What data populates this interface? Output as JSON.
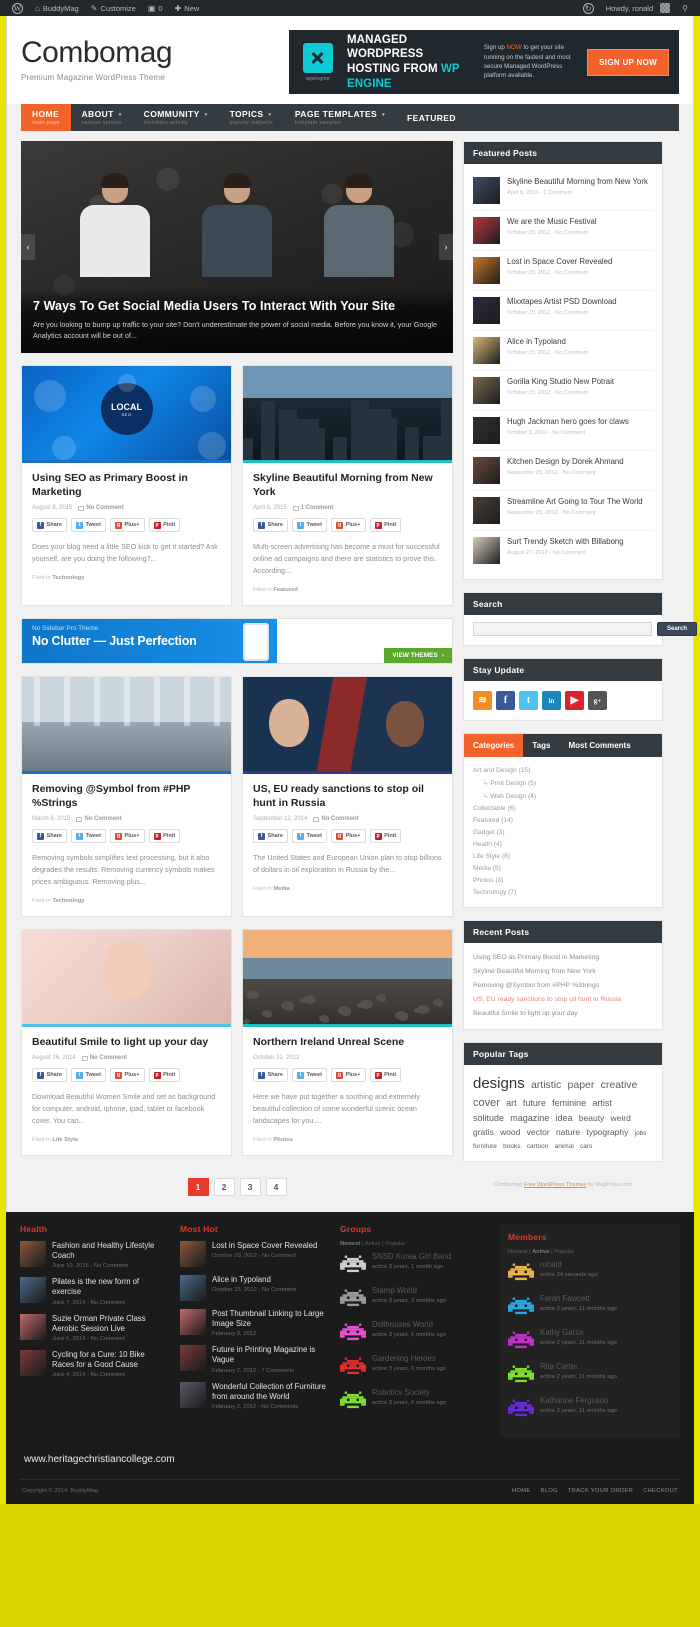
{
  "adminbar": {
    "wp_logo": "wordpress-logo-icon",
    "site_name": "BuddyMag",
    "customize": "Customize",
    "comment_count": "0",
    "new": "New",
    "howdy": "Howdy, ronald",
    "updates_icon": "updates-icon",
    "search_icon": "search-icon"
  },
  "header": {
    "title": "Combomag",
    "tagline": "Premium Magazine WordPress Theme",
    "ad": {
      "logo_label": "wpengine",
      "headline_line1": "MANAGED WORDPRESS",
      "headline_line2": "HOSTING FROM ",
      "headline_brand": "WP ENGINE",
      "body_pre": "Sign up ",
      "body_now": "NOW",
      "body_post": " to get your site running on the fastest and most secure Managed WordPress platform available.",
      "cta": "SIGN UP NOW"
    }
  },
  "nav": [
    {
      "label": "HOME",
      "desc": "main page",
      "caret": false,
      "active": true
    },
    {
      "label": "ABOUT",
      "desc": "various options",
      "caret": true,
      "active": false
    },
    {
      "label": "COMMUNITY",
      "desc": "members activity",
      "caret": true,
      "active": false
    },
    {
      "label": "TOPICS",
      "desc": "popular subjects",
      "caret": true,
      "active": false
    },
    {
      "label": "PAGE TEMPLATES",
      "desc": "template samples",
      "caret": true,
      "active": false
    },
    {
      "label": "FEATURED",
      "desc": "",
      "caret": false,
      "active": false
    }
  ],
  "hero": {
    "title": "7 Ways To Get Social Media Users To Interact With Your Site",
    "excerpt": "Are you looking to bump up traffic to your site? Don't underestimate the power of social media. Before you know it, your Google Analytics account will be out of...",
    "prev_icon": "chevron-left-icon",
    "next_icon": "chevron-right-icon"
  },
  "share": {
    "facebook": "Share",
    "twitter": "Tweet",
    "google": "Plus+",
    "pinterest": "Pinit"
  },
  "filed_label": "Filed in",
  "articles": [
    {
      "title": "Using SEO as Primary Boost in Marketing",
      "date": "August 8, 2015",
      "comments": "No Comment",
      "excerpt": "Does your blog need a little SEO kick to get it started? Ask yourself, are you doing the following?...",
      "filed": "Technology",
      "thumb": "seo-infographic-thumbnail",
      "accent": "#1b6fc4"
    },
    {
      "title": "Skyline Beautiful Morning from New York",
      "date": "April 8, 2015",
      "comments": "1 Comment",
      "excerpt": "Multi-screen advertising has become a must for successful online ad campaigns and there are statistics to prove this. According...",
      "filed": "Featured",
      "thumb": "city-skyline-thumbnail",
      "accent": "#1cc2c2"
    },
    {
      "title": "Removing @Symbol from #PHP %Strings",
      "date": "March 8, 2015",
      "comments": "No Comment",
      "excerpt": "Removing symbols simplifies text processing, but it also degrades the results. Removing currency symbols makes prices ambiguous. Removing plus...",
      "filed": "Technology",
      "thumb": "office-interior-thumbnail",
      "accent": "#1b6fc4"
    },
    {
      "title": "US, EU ready sanctions to stop oil hunt in Russia",
      "date": "September 12, 2014",
      "comments": "No Comment",
      "excerpt": "The United States and European Union plan to stop billions of dollars in oil exploration in Russia by the...",
      "filed": "Media",
      "thumb": "politicians-thumbnail",
      "accent": "#2b3a8f"
    },
    {
      "title": "Beautiful Smile to light up your day",
      "date": "August 26, 2014",
      "comments": "No Comment",
      "excerpt": "Download Beautiful Women Smile and set as background for computer, android, iphone, ipad, tablet or facebook cover. You can...",
      "filed": "Life Style",
      "thumb": "smiling-woman-thumbnail",
      "accent": "#4fc3e8"
    },
    {
      "title": "Northern Ireland Unreal Scene",
      "date": "October 21, 2012",
      "comments": "",
      "excerpt": "Here we have put together a soothing and extremely beautiful collection of some wonderful scenic ocean landscapes for you....",
      "filed": "Photos",
      "thumb": "coastal-ruins-thumbnail",
      "accent": "#1cc2c2"
    }
  ],
  "midbanner": {
    "small": "No Sidebar Pro Theme",
    "big": "No Clutter — Just Perfection",
    "cta": "VIEW THEMES",
    "cta_icon": "chevron-right-icon"
  },
  "pagination": {
    "pages": [
      "1",
      "2",
      "3",
      "4"
    ],
    "current": "1"
  },
  "sidebar": {
    "featured_posts": {
      "title": "Featured Posts",
      "items": [
        {
          "title": "Skyline Beautiful Morning from New York",
          "meta": "April 8, 2015 - 1 Comment",
          "thumb": "skyline-thumb"
        },
        {
          "title": "We are the Music Festival",
          "meta": "October 20, 2012 - No Comment",
          "thumb": "music-festival-thumb"
        },
        {
          "title": "Lost in Space Cover Revealed",
          "meta": "October 20, 2012 - No Comment",
          "thumb": "lost-in-space-thumb"
        },
        {
          "title": "Mixxtapes Artist PSD Download",
          "meta": "October 15, 2012 - No Comment",
          "thumb": "mixxtapes-thumb"
        },
        {
          "title": "Alice in Typoland",
          "meta": "October 15, 2012 - No Comment",
          "thumb": "alice-typoland-thumb"
        },
        {
          "title": "Gorilla King Studio New Potrait",
          "meta": "October 15, 2012 - No Comment",
          "thumb": "gorilla-king-thumb"
        },
        {
          "title": "Hugh Jackman hero goes for claws",
          "meta": "October 3, 2012 - No Comment",
          "thumb": "hugh-jackman-thumb"
        },
        {
          "title": "Kitchen Design by Dorek Ahmand",
          "meta": "September 29, 2012 - No Comment",
          "thumb": "kitchen-design-thumb"
        },
        {
          "title": "Streamline Art Going to Tour The World",
          "meta": "September 29, 2012 - No Comment",
          "thumb": "streamline-art-thumb"
        },
        {
          "title": "Surt Trendy Sketch with Billabong",
          "meta": "August 27, 2012 - No Comment",
          "thumb": "surf-sketch-thumb"
        }
      ]
    },
    "search": {
      "title": "Search",
      "value": "",
      "placeholder": "",
      "button": "Search"
    },
    "stay_update": {
      "title": "Stay Update",
      "icons": [
        {
          "name": "rss-icon",
          "glyph": "≋"
        },
        {
          "name": "facebook-icon",
          "glyph": "f"
        },
        {
          "name": "twitter-icon",
          "glyph": "t"
        },
        {
          "name": "linkedin-icon",
          "glyph": "in"
        },
        {
          "name": "youtube-icon",
          "glyph": "▶"
        },
        {
          "name": "google-plus-icon",
          "glyph": "g+"
        }
      ]
    },
    "tabs": [
      {
        "label": "Categories",
        "active": true
      },
      {
        "label": "Tags",
        "active": false
      },
      {
        "label": "Most Comments",
        "active": false
      }
    ],
    "categories": [
      {
        "label": "Art and Design (15)",
        "sub": false
      },
      {
        "label": "Print Design (5)",
        "sub": true
      },
      {
        "label": "Web Design (4)",
        "sub": true
      },
      {
        "label": "Collectable (6)",
        "sub": false
      },
      {
        "label": "Featured (14)",
        "sub": false
      },
      {
        "label": "Gadget (3)",
        "sub": false
      },
      {
        "label": "Health (4)",
        "sub": false
      },
      {
        "label": "Life Style (8)",
        "sub": false
      },
      {
        "label": "Media (5)",
        "sub": false
      },
      {
        "label": "Photos (3)",
        "sub": false
      },
      {
        "label": "Technology (7)",
        "sub": false
      }
    ],
    "recent_posts": {
      "title": "Recent Posts",
      "items": [
        {
          "label": "Using SEO as Primary Boost in Marketing",
          "highlight": false
        },
        {
          "label": "Skyline Beautiful Morning from New York",
          "highlight": false
        },
        {
          "label": "Removing @Symbol from #PHP %Strings",
          "highlight": false
        },
        {
          "label": "US, EU ready sanctions to stop oil hunt in Russia",
          "highlight": true
        },
        {
          "label": "Beautiful Smile to light up your day",
          "highlight": false
        }
      ]
    },
    "popular_tags": {
      "title": "Popular Tags",
      "tags": [
        {
          "label": "designs",
          "size": 15
        },
        {
          "label": "artistic",
          "size": 10.5
        },
        {
          "label": "paper",
          "size": 10.5
        },
        {
          "label": "creative",
          "size": 10.5
        },
        {
          "label": "cover",
          "size": 11
        },
        {
          "label": "art",
          "size": 9
        },
        {
          "label": "future",
          "size": 9
        },
        {
          "label": "feminine",
          "size": 9
        },
        {
          "label": "artist",
          "size": 9
        },
        {
          "label": "solitude",
          "size": 9
        },
        {
          "label": "magazine",
          "size": 9
        },
        {
          "label": "idea",
          "size": 9
        },
        {
          "label": "beauty",
          "size": 8.5
        },
        {
          "label": "weird",
          "size": 8.5
        },
        {
          "label": "gratis",
          "size": 8.5
        },
        {
          "label": "wood",
          "size": 8.5
        },
        {
          "label": "vector",
          "size": 8.5
        },
        {
          "label": "nature",
          "size": 8.5
        },
        {
          "label": "typography",
          "size": 8.5
        },
        {
          "label": "jobs",
          "size": 6.5
        },
        {
          "label": "furniture",
          "size": 6.5
        },
        {
          "label": "books",
          "size": 6.5
        },
        {
          "label": "cartoon",
          "size": 6.5
        },
        {
          "label": "animal",
          "size": 6.5
        },
        {
          "label": "cars",
          "size": 6.5
        }
      ]
    },
    "credit_pre": "Combomag ",
    "credit_link": "Free WordPress Themes",
    "credit_post": " by MagPress.com"
  },
  "footer": {
    "health": {
      "title": "Health",
      "items": [
        {
          "title": "Fashion and Healthy Lifestyle Coach",
          "meta": "June 10, 2015 - No Comment",
          "thumb": "fashion-coach-thumb"
        },
        {
          "title": "Pilates is the new form of exercise",
          "meta": "June 7, 2014 - No Comment",
          "thumb": "pilates-thumb"
        },
        {
          "title": "Suzie Orman Private Class Aerobic Session Live",
          "meta": "June 6, 2014 - No Comment",
          "thumb": "aerobic-thumb"
        },
        {
          "title": "Cycling for a Cure: 10 Bike Races for a Good Cause",
          "meta": "June 4, 2014 - No Comment",
          "thumb": "cycling-thumb"
        }
      ]
    },
    "most_hot": {
      "title": "Most Hot",
      "items": [
        {
          "title": "Lost in Space Cover Revealed",
          "meta": "October 20, 2012 - No Comment",
          "thumb": "lost-space-thumb"
        },
        {
          "title": "Alice in Typoland",
          "meta": "October 15, 2012 - No Comment",
          "thumb": "alice-thumb"
        },
        {
          "title": "Post Thumbnail Linking to Large Image Size",
          "meta": "February 3, 2012",
          "thumb": "post-thumbnail-thumb"
        },
        {
          "title": "Future in Printing Magazine is Vague",
          "meta": "February 2, 2012 - 7 Comments",
          "thumb": "printing-thumb"
        },
        {
          "title": "Wonderful Collection of Furniture from around the World",
          "meta": "February 2, 2012 - No Comments",
          "thumb": "furniture-thumb"
        }
      ]
    },
    "groups": {
      "title": "Groups",
      "filters": [
        "Newest",
        "Active",
        "Popular"
      ],
      "active_filter": "Newest",
      "items": [
        {
          "name": "SNSD Korea Girl Band",
          "meta": "active 3 years, 1 month ago",
          "color": "#cfcfcf"
        },
        {
          "name": "Stamp World",
          "meta": "active 3 years, 3 months ago",
          "color": "#9a9a9a"
        },
        {
          "name": "Dollhouses World",
          "meta": "active 3 years, 6 months ago",
          "color": "#e94fd0"
        },
        {
          "name": "Gardening Heroes",
          "meta": "active 3 years, 6 months ago",
          "color": "#e02c2c"
        },
        {
          "name": "Robotics Society",
          "meta": "active 3 years, 6 months ago",
          "color": "#7ee02c"
        }
      ]
    },
    "members": {
      "title": "Members",
      "filters": [
        "Newest",
        "Active",
        "Popular"
      ],
      "active_filter": "Active",
      "items": [
        {
          "name": "ronald",
          "meta": "active 24 seconds ago",
          "color": "#e8b44a"
        },
        {
          "name": "Farah Fawcett",
          "meta": "active 2 years, 11 months ago",
          "color": "#29a8e0"
        },
        {
          "name": "Kathy Garza",
          "meta": "active 2 years, 11 months ago",
          "color": "#c230c8"
        },
        {
          "name": "Rita Carter",
          "meta": "active 2 years, 11 months ago",
          "color": "#7ee02c"
        },
        {
          "name": "Katharine Ferguson",
          "meta": "active 2 years, 11 months ago",
          "color": "#6a28d8"
        }
      ]
    },
    "watermark": "www.heritagechristiancollege.com",
    "copyright": "Copyright © 2014. BuddyMag",
    "links": [
      "HOME",
      "BLOG",
      "TRACK YOUR ORDER",
      "CHECKOUT"
    ]
  }
}
